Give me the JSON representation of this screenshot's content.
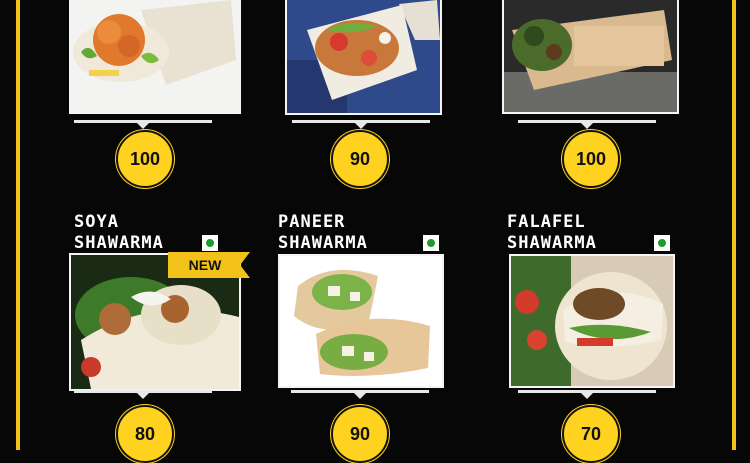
{
  "colors": {
    "background": "#070707",
    "frame": "#f2c21b",
    "price_circle": "#ffd21f",
    "veg_mark": "#1f9a2e"
  },
  "top_row": [
    {
      "price": "100"
    },
    {
      "price": "90"
    },
    {
      "price": "100"
    }
  ],
  "bottom_row": [
    {
      "name_line1": "SOYA",
      "name_line2": "SHAWARMA",
      "price": "80",
      "badge": "NEW",
      "veg_icon": "veg-mark-icon"
    },
    {
      "name_line1": "PANEER",
      "name_line2": "SHAWARMA",
      "price": "90",
      "veg_icon": "veg-mark-icon"
    },
    {
      "name_line1": "FALAFEL",
      "name_line2": "SHAWARMA",
      "price": "70",
      "veg_icon": "veg-mark-icon"
    }
  ]
}
